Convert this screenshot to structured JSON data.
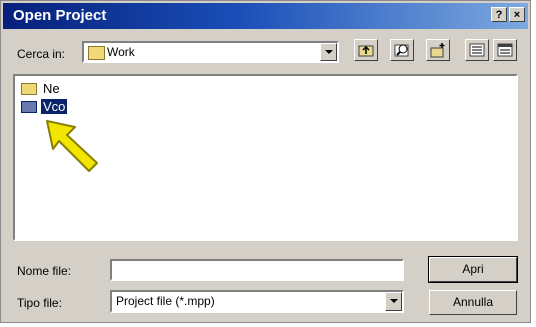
{
  "window": {
    "title": "Open Project"
  },
  "title_buttons": {
    "help": "?",
    "close": "×"
  },
  "lookin": {
    "label": "Cerca in:",
    "value": "Work"
  },
  "toolbar": {
    "up_icon": "up-one-level-icon",
    "refresh_icon": "web-search-icon",
    "new_folder_icon": "new-folder-icon",
    "list_icon": "list-view-icon",
    "details_icon": "details-view-icon"
  },
  "files": [
    {
      "name": "Ne",
      "selected": false
    },
    {
      "name": "Vco",
      "selected": true
    }
  ],
  "pointer": {
    "icon": "arrow-pointer-icon",
    "color": "#f2e600"
  },
  "filename": {
    "label": "Nome file:",
    "value": ""
  },
  "filetype": {
    "label": "Tipo file:",
    "value": "Project file (*.mpp)"
  },
  "buttons": {
    "open": "Apri",
    "cancel": "Annulla"
  },
  "colors": {
    "titlebar_start": "#06207a",
    "titlebar_end": "#7ea9e0",
    "selection": "#0a246a",
    "face": "#d4d0c8"
  }
}
